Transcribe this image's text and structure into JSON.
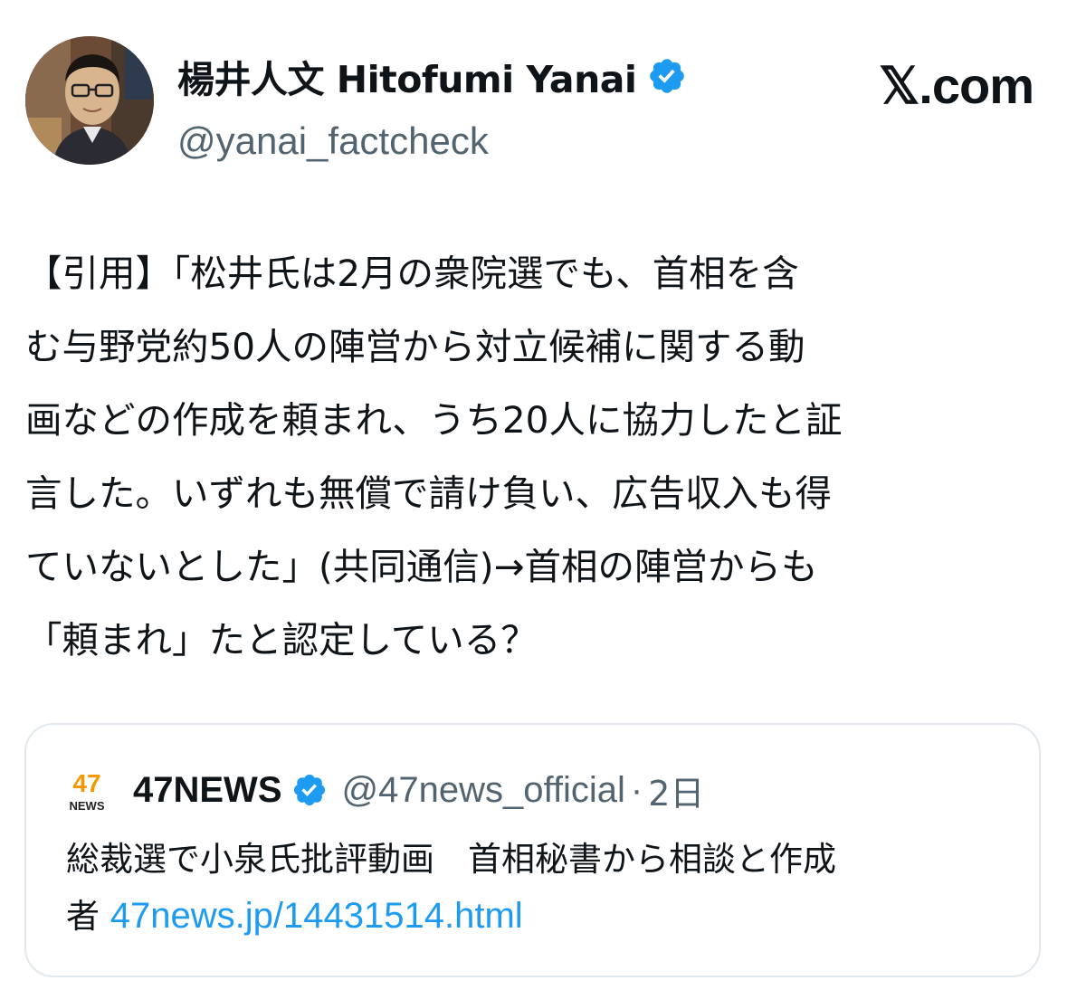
{
  "author": {
    "display_name": "楊井人文 Hitofumi Yanai",
    "handle": "@yanai_factcheck",
    "verified": true
  },
  "site_label": "𝕏.com",
  "tweet": {
    "lines": [
      "【引用】「松井氏は2月の衆院選でも、首相を含",
      "む与野党約50人の陣営から対立候補に関する動",
      "画などの作成を頼まれ、うち20人に協力したと証",
      "言した。いずれも無償で請け負い、広告収入も得",
      "ていないとした」(共同通信)→首相の陣営からも",
      "「頼まれ」たと認定している？"
    ]
  },
  "quoted": {
    "logo_text": "47",
    "logo_subtext": "NEWS",
    "name": "47NEWS",
    "verified": true,
    "handle": "@47news_official",
    "separator": "·",
    "time": "2日",
    "text_line1": "総裁選で小泉氏批評動画　首相秘書から相談と作成",
    "text_line2_prefix": "者",
    "link": "47news.jp/14431514.html"
  },
  "colors": {
    "text": "#0f1419",
    "secondary": "#536471",
    "link": "#1d9bf0",
    "verified_badge": "#1d9bf0",
    "border": "#e1e8ed",
    "logo_orange": "#f39800"
  },
  "icons": {
    "verified": "verified-badge-icon",
    "avatar": "avatar-photo"
  }
}
